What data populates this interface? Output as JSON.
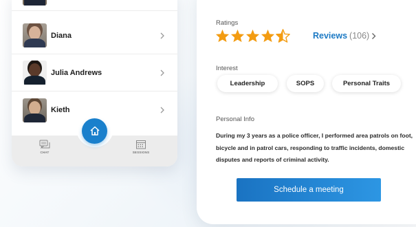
{
  "contacts": [
    {
      "name": "",
      "avatar": "officer-photo"
    },
    {
      "name": "Diana",
      "avatar": "officer-photo"
    },
    {
      "name": "Julia Andrews",
      "avatar": "officer-photo"
    },
    {
      "name": "Kieth",
      "avatar": "officer-photo"
    }
  ],
  "bottom_nav": {
    "chat_label": "CHAT",
    "sessions_label": "SESSIONS",
    "home_icon": "home-icon"
  },
  "profile": {
    "ratings_label": "Ratings",
    "rating_value": 4.5,
    "rating_max": 5,
    "reviews_link": "Reviews",
    "reviews_count": "(106)",
    "interest_label": "Interest",
    "interests": [
      "Leadership",
      "SOPS",
      "Personal Traits"
    ],
    "personal_info_label": "Personal Info",
    "bio": "During my 3 years as a police officer, I performed area patrols on  foot, bicycle and in patrol cars, responding to traffic incidents, domestic disputes and reports of criminal activity.",
    "schedule_button": "Schedule a meeting"
  },
  "colors": {
    "accent": "#1a80cc",
    "star": "#f39c12",
    "link": "#1d7ac4"
  }
}
